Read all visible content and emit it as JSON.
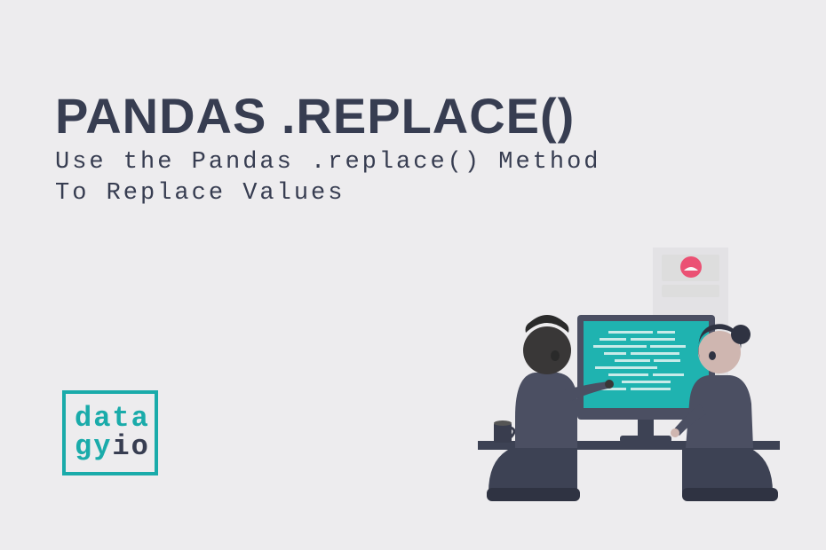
{
  "title": "PANDAS .REPLACE()",
  "subtitle": "Use the Pandas .replace() Method\nTo Replace Values",
  "logo": {
    "line1": "data",
    "line2_gy": "gy",
    "line2_io": "io"
  },
  "colors": {
    "background": "#edecee",
    "text_dark": "#373d51",
    "accent_teal": "#1aabaa",
    "accent_pink": "#eb5174",
    "screen": "#1fb3b0",
    "skin_dark": "#393737",
    "skin_light": "#cfb6b0",
    "clothing": "#4b4f62"
  }
}
